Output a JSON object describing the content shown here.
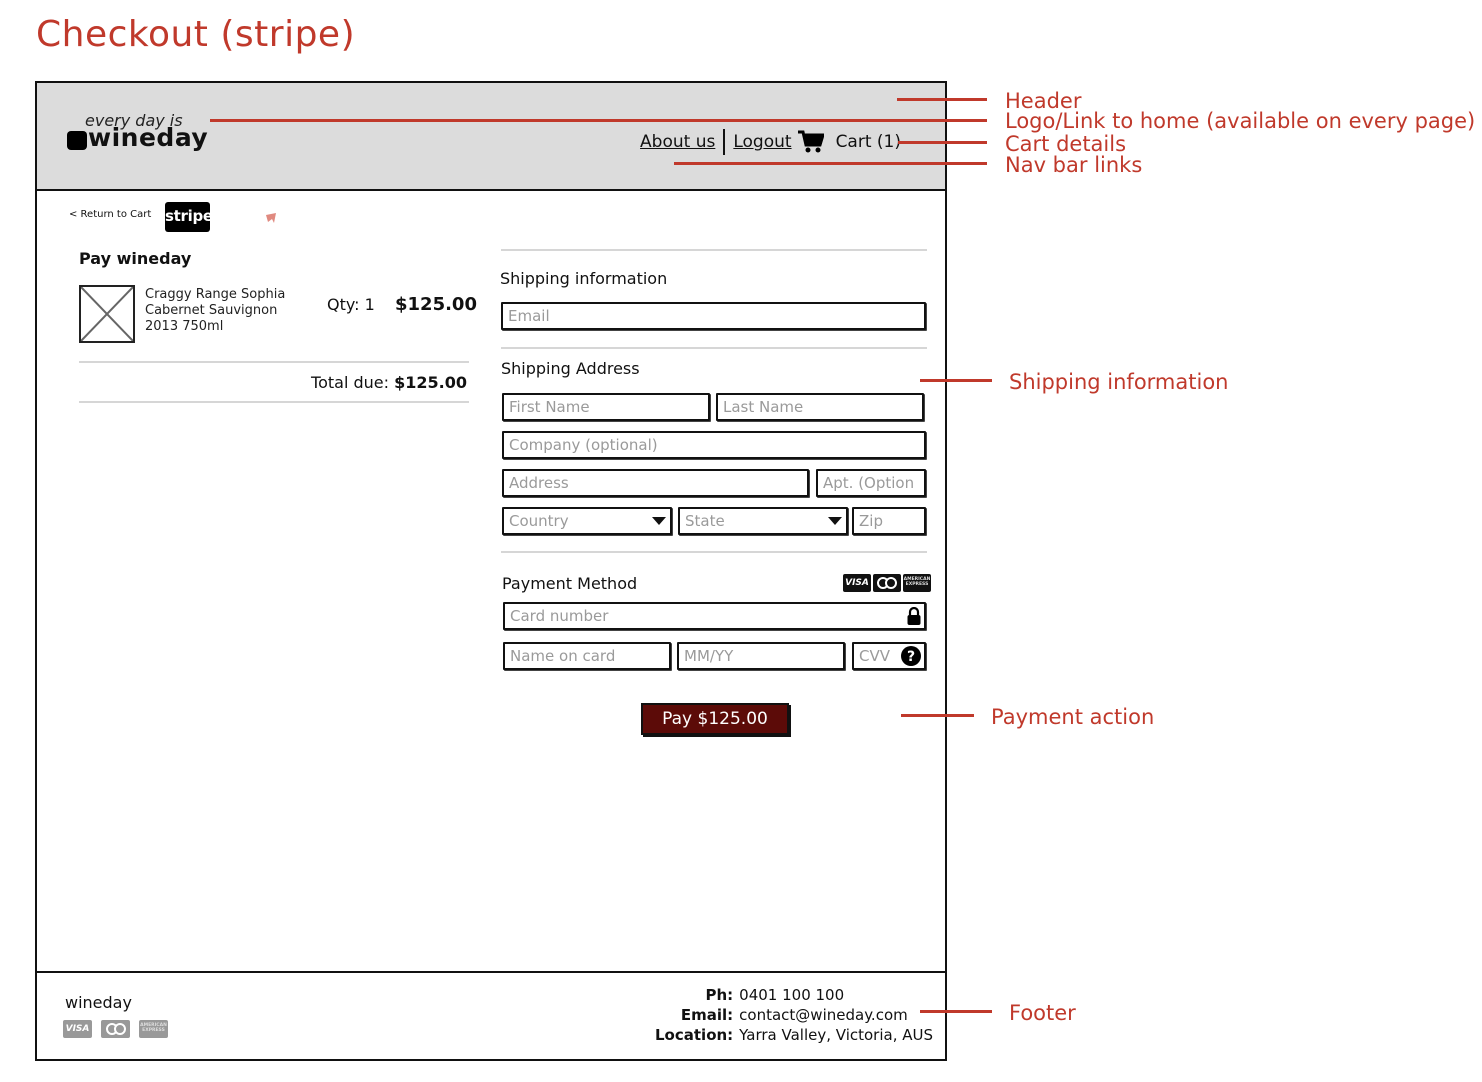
{
  "page_title": "Checkout (stripe)",
  "header": {
    "logo_tagline": "every day is",
    "logo_name": "wineday",
    "nav": {
      "about": "About us",
      "logout": "Logout",
      "cart": "Cart (1)"
    }
  },
  "checkout": {
    "return_link": "< Return to Cart",
    "stripe_badge": "stripe",
    "summary_title": "Pay wineday",
    "item": {
      "name_line1": "Craggy Range Sophia",
      "name_line2": "Cabernet Sauvignon",
      "name_line3": "2013 750ml",
      "qty": "Qty: 1",
      "price": "$125.00"
    },
    "total_label": "Total due:",
    "total_value": "$125.00"
  },
  "form": {
    "shipping_info_label": "Shipping information",
    "email_placeholder": "Email",
    "shipping_address_label": "Shipping Address",
    "first_name_placeholder": "First Name",
    "last_name_placeholder": "Last Name",
    "company_placeholder": "Company (optional)",
    "address_placeholder": "Address",
    "apt_placeholder": "Apt. (Option",
    "country_placeholder": "Country",
    "state_placeholder": "State",
    "zip_placeholder": "Zip",
    "payment_label": "Payment Method",
    "card_brands": [
      "VISA",
      "MasterCard",
      "American Express"
    ],
    "card_number_placeholder": "Card number",
    "name_on_card_placeholder": "Name on card",
    "expiry_placeholder": "MM/YY",
    "cvv_placeholder": "CVV",
    "pay_button": "Pay $125.00"
  },
  "footer": {
    "brand": "wineday",
    "card_brands": [
      "VISA",
      "MasterCard",
      "American Express"
    ],
    "contact": [
      {
        "key": "Ph:",
        "value": "0401 100 100"
      },
      {
        "key": "Email:",
        "value": "contact@wineday.com"
      },
      {
        "key": "Location:",
        "value": "Yarra Valley, Victoria, AUS"
      }
    ]
  },
  "annotations": {
    "header": "Header",
    "logo": "Logo/Link to home (available on every page)",
    "cart": "Cart details",
    "nav": "Nav bar links",
    "shipping": "Shipping information",
    "payment": "Payment action",
    "footer": "Footer"
  },
  "colors": {
    "annotation": "#c0392b",
    "header_bg": "#dcdcdc",
    "pay_button": "#5c0b08"
  }
}
